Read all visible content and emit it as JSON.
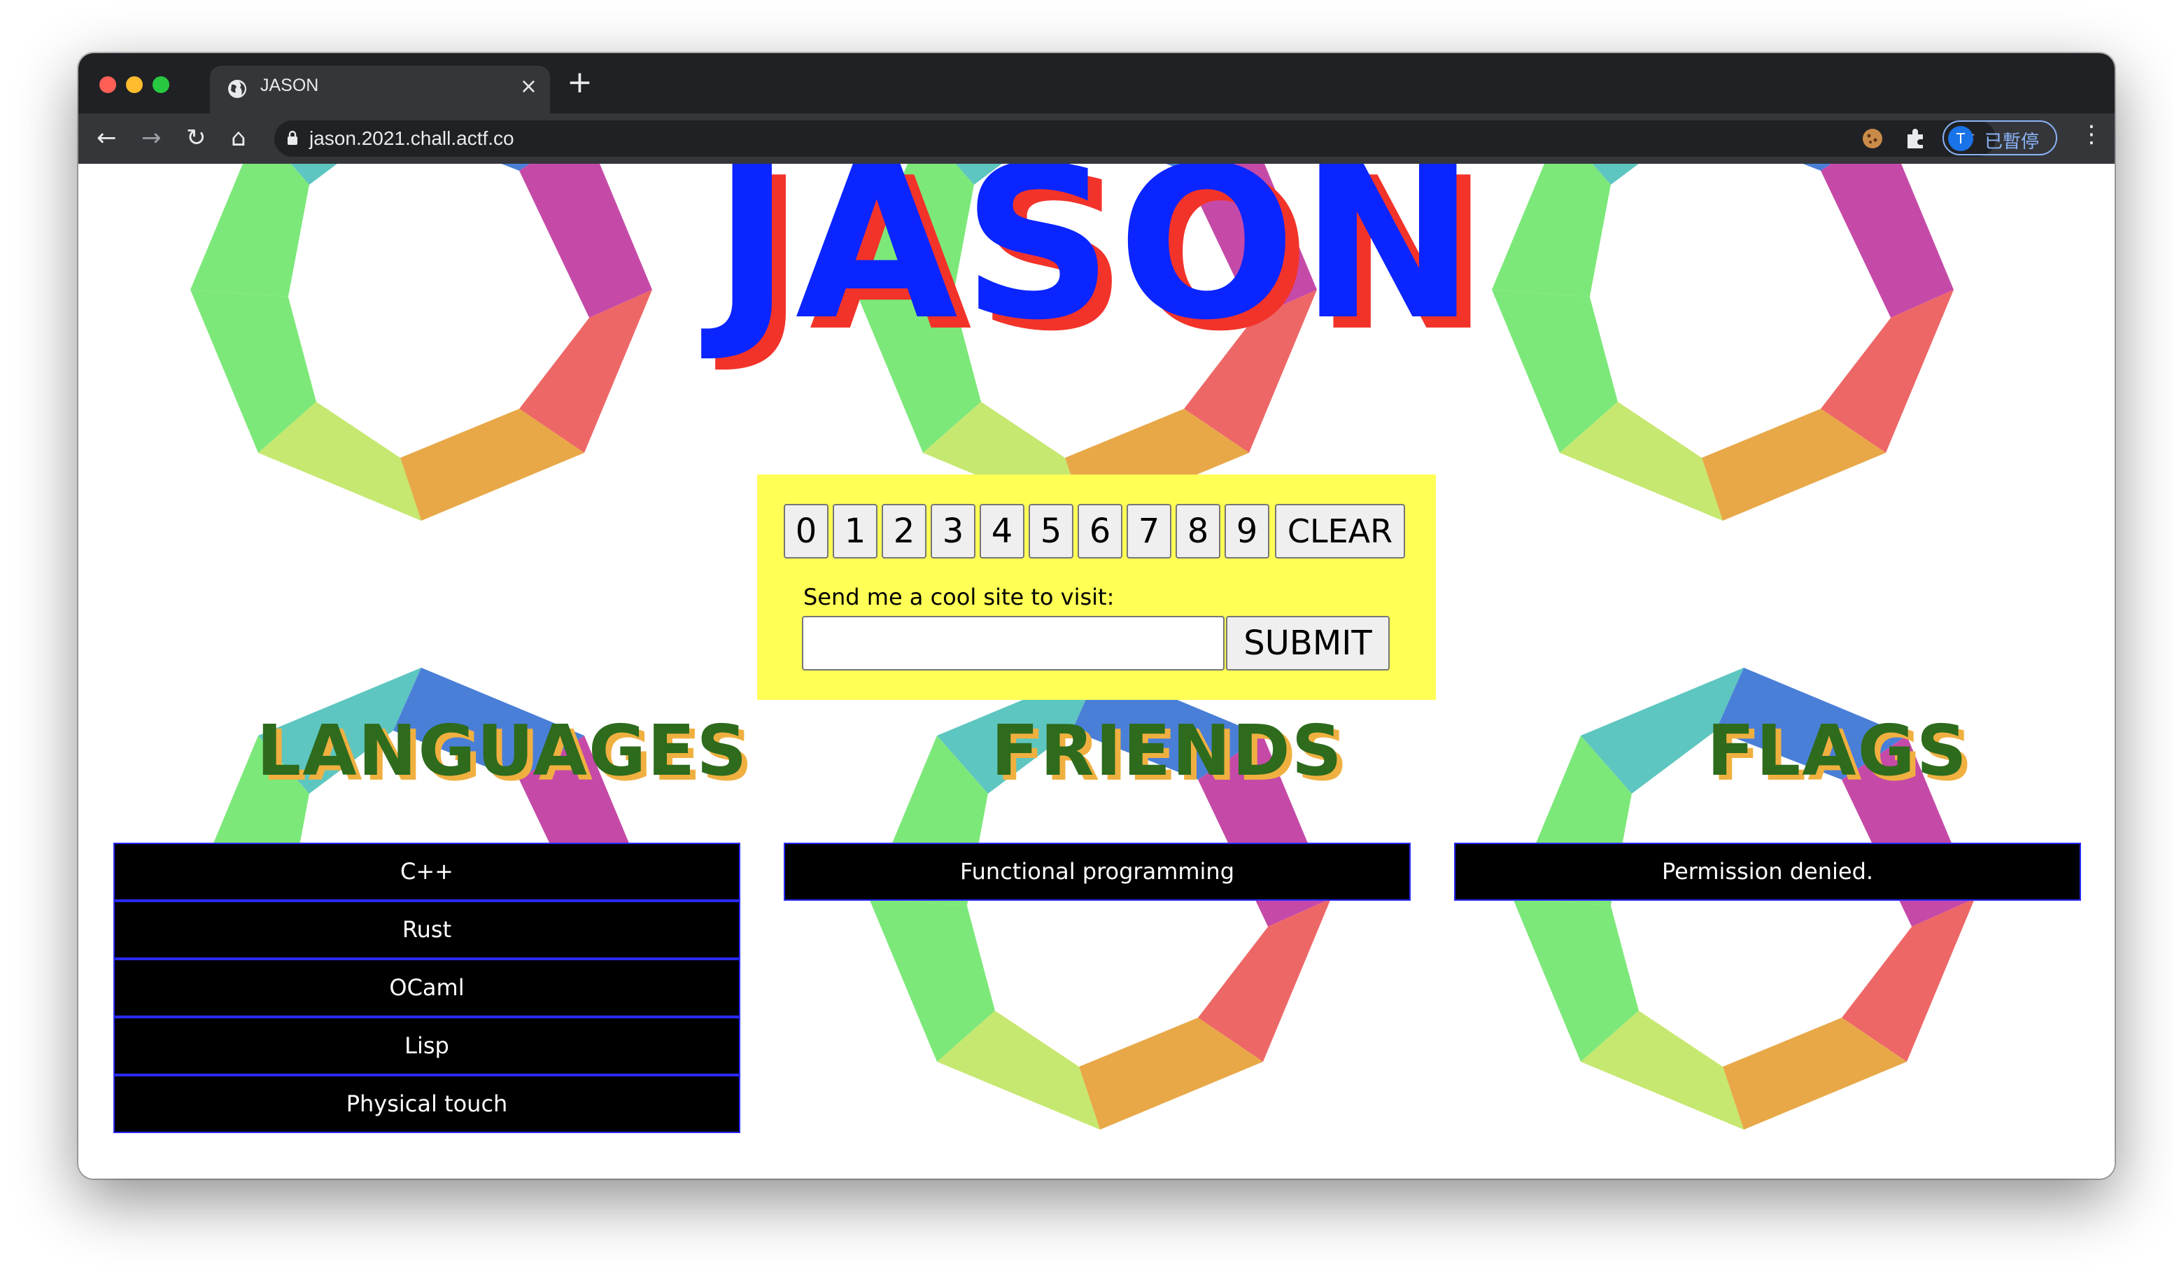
{
  "browser": {
    "tab_title": "JASON",
    "tab_close": "×",
    "new_tab": "+",
    "url": "jason.2021.chall.actf.co",
    "profile_initial": "T",
    "profile_status": "已暫停",
    "back": "←",
    "forward": "→",
    "reload": "↻",
    "home": "⌂",
    "star": "☆",
    "menu": "⋮",
    "traffic_colors": [
      "#ff5f57",
      "#febc2e",
      "#28c840"
    ]
  },
  "page": {
    "title": "JASON",
    "digits": [
      "0",
      "1",
      "2",
      "3",
      "4",
      "5",
      "6",
      "7",
      "8",
      "9"
    ],
    "clear_label": "CLEAR",
    "send_label": "Send me a cool site to visit:",
    "input_value": "",
    "submit_label": "SUBMIT"
  },
  "sections": {
    "languages": {
      "heading": "LANGUAGES",
      "items": [
        "C++",
        "Rust",
        "OCaml",
        "Lisp",
        "Physical touch"
      ]
    },
    "friends": {
      "heading": "FRIENDS",
      "items": [
        "Functional programming"
      ]
    },
    "flags": {
      "heading": "FLAGS",
      "items": [
        "Permission denied."
      ]
    }
  },
  "colors": {
    "title_fill": "#0a25ff",
    "title_shadow": "#f2332a",
    "panel": "#ffff55",
    "heading": "#2e6b1d",
    "heading_shadow": "#f0b040"
  }
}
